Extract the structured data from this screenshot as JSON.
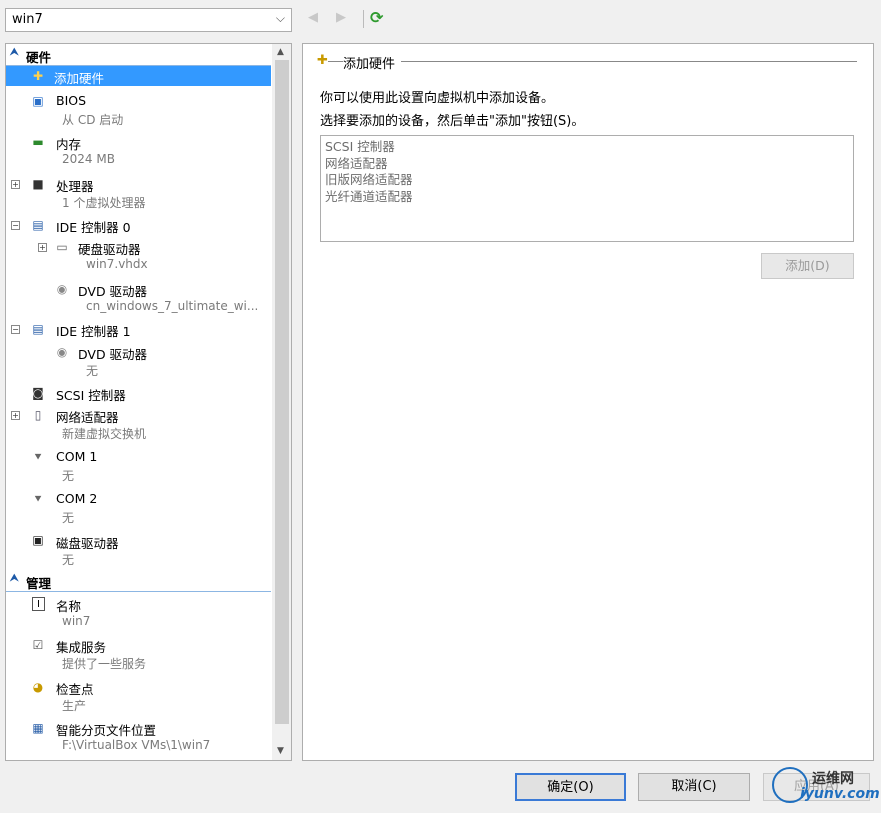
{
  "vm_select": {
    "value": "win7"
  },
  "nav": {
    "back": "◀",
    "forward": "▶",
    "refresh": "⟳"
  },
  "tree": {
    "hardware_section": "硬件",
    "add_hardware": "添加硬件",
    "bios": {
      "label": "BIOS",
      "sub": "从 CD 启动"
    },
    "memory": {
      "label": "内存",
      "sub": "2024 MB"
    },
    "processor": {
      "label": "处理器",
      "sub": "1 个虚拟处理器"
    },
    "ide0": {
      "label": "IDE 控制器 0"
    },
    "hdd": {
      "label": "硬盘驱动器",
      "sub": "win7.vhdx"
    },
    "dvd0": {
      "label": "DVD 驱动器",
      "sub": "cn_windows_7_ultimate_wi..."
    },
    "ide1": {
      "label": "IDE 控制器 1"
    },
    "dvd1": {
      "label": "DVD 驱动器",
      "sub": "无"
    },
    "scsi": {
      "label": "SCSI 控制器"
    },
    "nic": {
      "label": "网络适配器",
      "sub": "新建虚拟交换机"
    },
    "com1": {
      "label": "COM 1",
      "sub": "无"
    },
    "com2": {
      "label": "COM 2",
      "sub": "无"
    },
    "floppy": {
      "label": "磁盘驱动器",
      "sub": "无"
    },
    "management_section": "管理",
    "name": {
      "label": "名称",
      "sub": "win7"
    },
    "integration": {
      "label": "集成服务",
      "sub": "提供了一些服务"
    },
    "checkpoint": {
      "label": "检查点",
      "sub": "生产"
    },
    "paging": {
      "label": "智能分页文件位置",
      "sub": "F:\\VirtualBox VMs\\1\\win7"
    }
  },
  "panel": {
    "title": "添加硬件",
    "line1": "你可以使用此设置向虚拟机中添加设备。",
    "line2": "选择要添加的设备，然后单击\"添加\"按钮(S)。",
    "devices": [
      "SCSI 控制器",
      "网络适配器",
      "旧版网络适配器",
      "光纤通道适配器"
    ],
    "add_button": "添加(D)"
  },
  "buttons": {
    "ok": "确定(O)",
    "cancel": "取消(C)",
    "apply": "应用(A)"
  },
  "watermark": {
    "top": "运维网",
    "bottom": "iyunv.com"
  }
}
